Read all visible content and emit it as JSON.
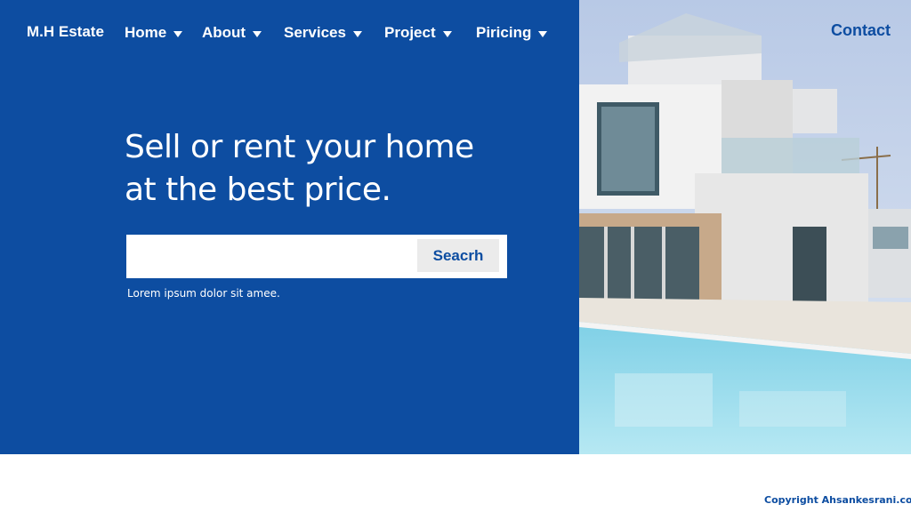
{
  "brand": {
    "name": "M.H Estate"
  },
  "nav": {
    "items": [
      {
        "label": "Home"
      },
      {
        "label": "About"
      },
      {
        "label": "Services"
      },
      {
        "label": "Project"
      },
      {
        "label": "Piricing"
      }
    ],
    "contact_label": "Contact"
  },
  "hero": {
    "headline_line1": "Sell or rent your home",
    "headline_line2": "at the best price.",
    "search": {
      "value": "",
      "placeholder": "",
      "button_label": "Seacrh"
    },
    "caption": "Lorem ipsum dolor sit amee."
  },
  "footer": {
    "copyright": "Copyright Ahsankesrani.com"
  },
  "colors": {
    "brand_blue": "#0d4da1",
    "search_button_bg": "#ebebeb",
    "white": "#ffffff"
  },
  "icons": {
    "nav_dropdown": "caret-down-icon"
  }
}
